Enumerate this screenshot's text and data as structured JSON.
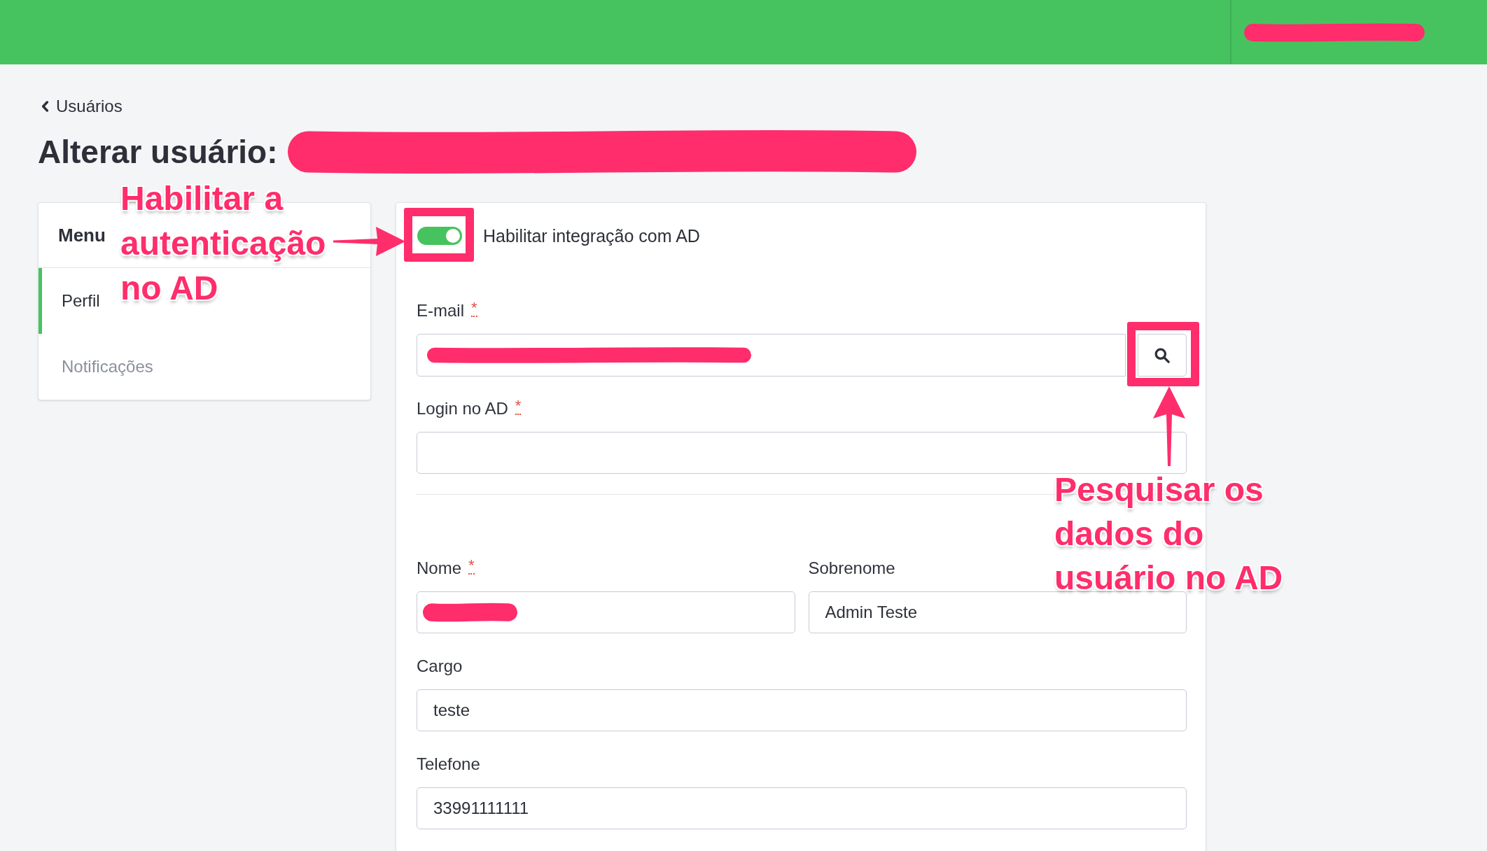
{
  "header": {
    "account_redacted": true
  },
  "breadcrumb": {
    "label": "Usuários"
  },
  "page_title": {
    "text": "Alterar usuário:",
    "redacted": true
  },
  "menu": {
    "title": "Menu",
    "items": [
      {
        "label": "Perfil",
        "selected": true
      },
      {
        "label": "Notificações",
        "selected": false
      }
    ]
  },
  "form": {
    "ad_toggle": {
      "label": "Habilitar integração com AD",
      "on": true
    },
    "ad_fields": [
      {
        "kind": "search",
        "label": "E-mail",
        "required_mark": "*",
        "redacted": true
      },
      {
        "kind": "text",
        "label": "Login no AD",
        "required_mark": "*",
        "redacted": false
      }
    ],
    "profile_rows": [
      {
        "fields": [
          {
            "kind": "text",
            "label": "Nome",
            "required_mark": "*",
            "redacted": true
          },
          {
            "kind": "text",
            "label": "Sobrenome",
            "value": "Admin Teste",
            "redacted": false
          }
        ]
      },
      {
        "fields": [
          {
            "kind": "text",
            "label": "Cargo",
            "value": "teste",
            "redacted": false
          }
        ]
      },
      {
        "fields": [
          {
            "kind": "text",
            "label": "Telefone",
            "value": "33991111111",
            "redacted": false
          }
        ]
      }
    ]
  },
  "annotations": [
    {
      "kind": "right_arrow",
      "text": "Habilitar a autenticação no AD"
    },
    {
      "kind": "up_arrow",
      "text": "Pesquisar os dados do usuário no AD"
    }
  ]
}
